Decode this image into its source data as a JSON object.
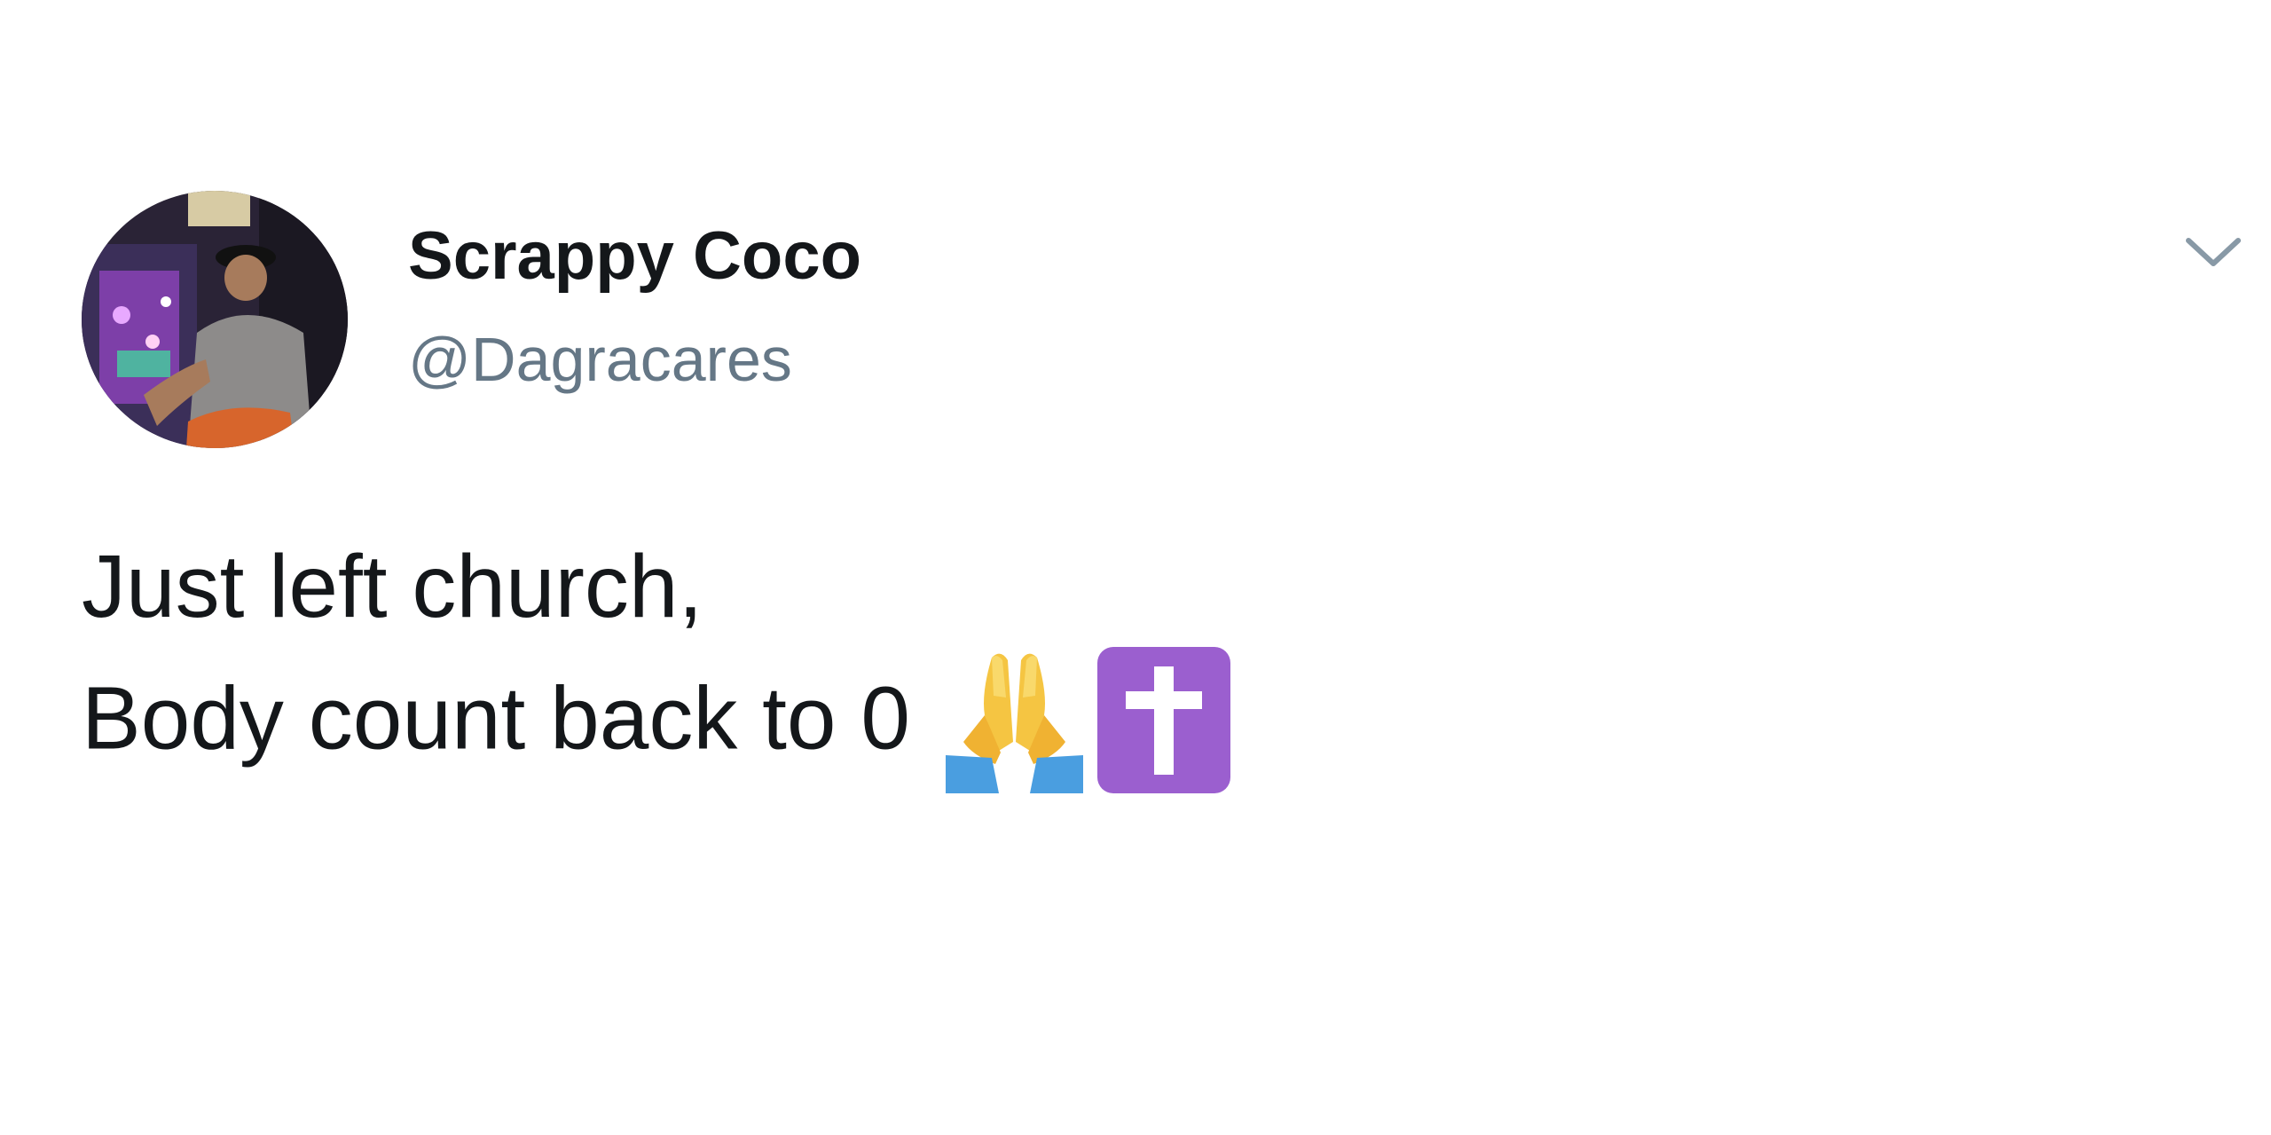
{
  "tweet": {
    "display_name": "Scrappy Coco",
    "handle": "@Dagracares",
    "text_line1": "Just left church,",
    "text_line2": "Body count back to 0",
    "emojis": [
      "folded-hands-emoji",
      "latin-cross-emoji"
    ]
  },
  "icons": {
    "caret": "chevron-down-icon"
  },
  "colors": {
    "name": "#14171a",
    "handle": "#657786",
    "caret": "#8899a6",
    "cross_bg": "#9b5fcf",
    "background": "#ffffff"
  }
}
